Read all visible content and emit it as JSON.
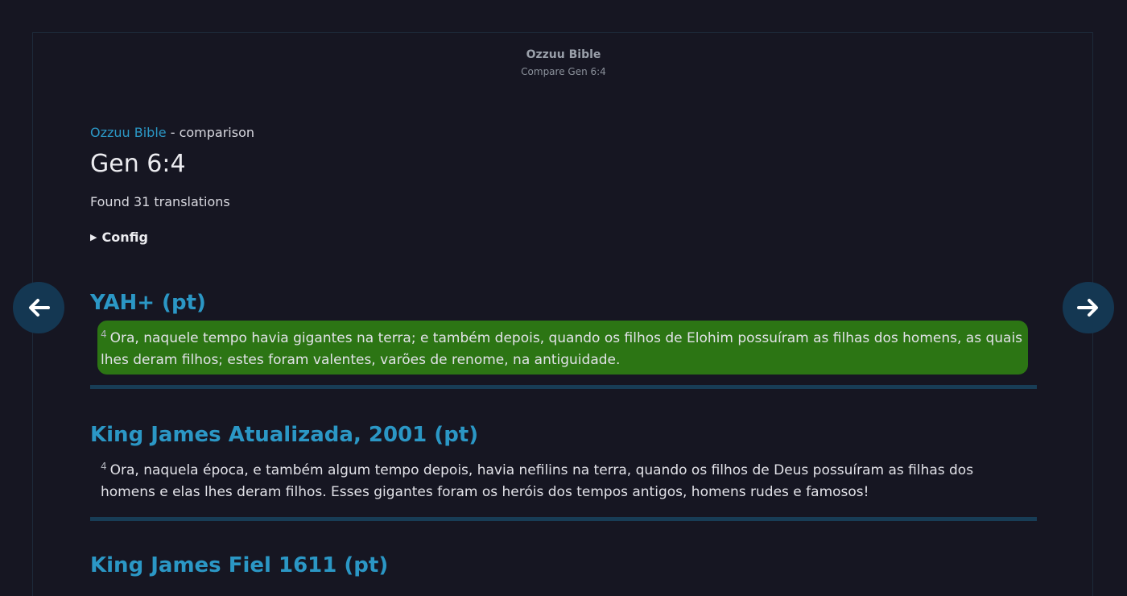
{
  "header": {
    "site_title": "Ozzuu Bible",
    "subtitle": "Compare Gen 6:4"
  },
  "breadcrumb": {
    "link": "Ozzuu Bible",
    "suffix": " - comparison"
  },
  "reference": "Gen 6:4",
  "found_text": "Found 31 translations",
  "config_label": "Config",
  "nav": {
    "prev_icon": "arrow-left-icon",
    "next_icon": "arrow-right-icon"
  },
  "colors": {
    "accent": "#2b97c5",
    "highlight": "#2c7514",
    "divider": "#183d56",
    "background": "#161622"
  },
  "translations": [
    {
      "name": "YAH+ (pt)",
      "verse_num": "4",
      "text": "Ora, naquele tempo havia gigantes na terra; e também depois, quando os filhos de Elohim possuíram as filhas dos homens, as quais lhes deram filhos; estes foram valentes, varões de renome, na antiguidade.",
      "highlighted": true
    },
    {
      "name": "King James Atualizada, 2001 (pt)",
      "verse_num": "4",
      "text": "Ora, naquela época, e também algum tempo depois, havia nefilins na terra, quando os filhos de Deus possuíram as filhas dos homens e elas lhes deram filhos. Esses gigantes foram os heróis dos tempos antigos, homens rudes e famosos!",
      "highlighted": false
    },
    {
      "name": "King James Fiel 1611 (pt)"
    }
  ]
}
